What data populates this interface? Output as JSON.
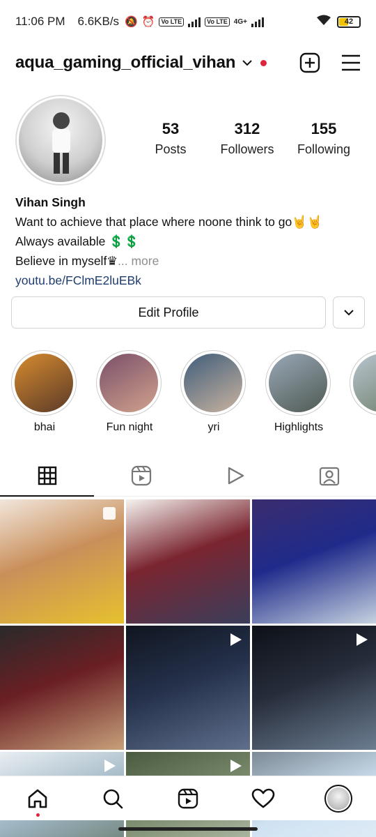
{
  "status": {
    "time": "11:06 PM",
    "speed": "6.6KB/s",
    "network": "4G+",
    "battery": "42",
    "volte": "Vo LTE",
    "battery_color": "#f2c200"
  },
  "header": {
    "username": "aqua_gaming_official_vihan",
    "notification_color": "#e0243a",
    "icons": [
      "chevron-down-icon",
      "create-new-icon",
      "menu-icon"
    ]
  },
  "stats": [
    {
      "num": "53",
      "label": "Posts"
    },
    {
      "num": "312",
      "label": "Followers"
    },
    {
      "num": "155",
      "label": "Following"
    }
  ],
  "bio": {
    "name": "Vihan Singh",
    "line1": "Want to achieve that place where noone think to go",
    "line1_emoji": "🤘🤘",
    "line2": "Always available ",
    "line2_emoji": "💲💲",
    "line3": "Believe in myself",
    "line3_emoji": "♛",
    "more": "... more",
    "link": "youtu.be/FClmE2luEBk"
  },
  "buttons": {
    "edit_profile": "Edit Profile"
  },
  "highlights": [
    {
      "label": "bhai",
      "color_a": "#d78b2f",
      "color_b": "#5a3a28"
    },
    {
      "label": "Fun night",
      "color_a": "#7a4f6a",
      "color_b": "#d1a28c"
    },
    {
      "label": "yri",
      "color_a": "#3f5d7a",
      "color_b": "#c9b3a0"
    },
    {
      "label": "Highlights",
      "color_a": "#9aa8b8",
      "color_b": "#4e5a52"
    },
    {
      "label": "",
      "color_a": "#b8c4cf",
      "color_b": "#6f7f6a"
    }
  ],
  "tabs": [
    "grid-icon",
    "reels-icon",
    "play-icon",
    "tagged-icon"
  ],
  "grid": [
    {
      "c1": "#c98f5a",
      "c2": "#e6c12e",
      "c3": "#f1e6dc",
      "badge": "multi"
    },
    {
      "c1": "#7a2530",
      "c2": "#3a3e5c",
      "c3": "#f5f3ef",
      "badge": ""
    },
    {
      "c1": "#1f2b8a",
      "c2": "#c6d2e0",
      "c3": "#3b2c6e",
      "badge": ""
    },
    {
      "c1": "#6a1f24",
      "c2": "#c7a07a",
      "c3": "#2a2a2a",
      "badge": ""
    },
    {
      "c1": "#24304a",
      "c2": "#5f6f8c",
      "c3": "#10151f",
      "badge": "reel"
    },
    {
      "c1": "#262c3a",
      "c2": "#6b7d90",
      "c3": "#0d1118",
      "badge": "reel"
    },
    {
      "c1": "#9fb6c4",
      "c2": "#5a6b55",
      "c3": "#e9eef2",
      "badge": "reel"
    },
    {
      "c1": "#7f8f71",
      "c2": "#c7d0c0",
      "c3": "#4a5a40",
      "badge": "reel"
    },
    {
      "c1": "#cfe2f2",
      "c2": "#e8f1f8",
      "c3": "#7c8a96",
      "badge": ""
    }
  ]
}
